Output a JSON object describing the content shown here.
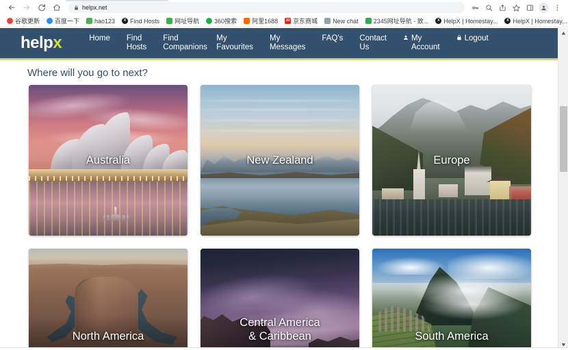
{
  "browser": {
    "back_icon": "back-arrow-icon",
    "forward_icon": "forward-arrow-icon",
    "reload_icon": "reload-icon",
    "home_icon": "home-icon",
    "url": "helpx.net",
    "lock_icon": "lock-icon",
    "actions": [
      {
        "name": "password-key-icon",
        "glyph": "key"
      },
      {
        "name": "zoom-icon",
        "glyph": "zoom"
      },
      {
        "name": "share-icon",
        "glyph": "share"
      },
      {
        "name": "bookmark-star-icon",
        "glyph": "star"
      },
      {
        "name": "side-panel-icon",
        "glyph": "panel"
      },
      {
        "name": "profile-avatar-icon",
        "glyph": "avatar"
      },
      {
        "name": "chrome-menu-icon",
        "glyph": "kebab"
      }
    ],
    "bookmarks": [
      {
        "label": "谷歌更新",
        "color": "#ea4335",
        "mark": "",
        "shape": "circle"
      },
      {
        "label": "百度一下",
        "color": "#2d8cf0",
        "mark": "",
        "shape": "circle"
      },
      {
        "label": "hao123",
        "color": "#4caf50",
        "mark": "",
        "shape": "square"
      },
      {
        "label": "Find Hosts",
        "color": "#1a1a1a",
        "mark": "X",
        "shape": "circle"
      },
      {
        "label": "网址导航",
        "color": "#37b24d",
        "mark": "",
        "shape": "square"
      },
      {
        "label": "360搜索",
        "color": "#1faf4a",
        "mark": "",
        "shape": "circle"
      },
      {
        "label": "阿里1688",
        "color": "#ff6a00",
        "mark": "",
        "shape": "square"
      },
      {
        "label": "京东商城",
        "color": "#e1251b",
        "mark": "JD",
        "shape": "square"
      },
      {
        "label": "New chat",
        "color": "#8fa3a8",
        "mark": "",
        "shape": "square"
      },
      {
        "label": "2345网址导航 - 致...",
        "color": "#3aa757",
        "mark": "",
        "shape": "square"
      },
      {
        "label": "HelpX | Homestay...",
        "color": "#1a1a1a",
        "mark": "X",
        "shape": "circle"
      },
      {
        "label": "HelpX | Homestay...",
        "color": "#1a1a1a",
        "mark": "X",
        "shape": "circle"
      }
    ],
    "bookmarks_overflow": "»"
  },
  "site": {
    "logo": {
      "primary": "help",
      "accent": "x"
    },
    "nav_items": [
      {
        "label": "Home",
        "icon": null
      },
      {
        "label": "Find\nHosts",
        "icon": null
      },
      {
        "label": "Find\nCompanions",
        "icon": null
      },
      {
        "label": "My\nFavourites",
        "icon": null
      },
      {
        "label": "My\nMessages",
        "icon": null
      },
      {
        "label": "FAQ's",
        "icon": null
      },
      {
        "label": "Contact\nUs",
        "icon": null
      },
      {
        "label": "My\nAccount",
        "icon": "user-icon"
      },
      {
        "label": "Logout",
        "icon": "lock-icon"
      }
    ],
    "heading": "Where will you go to next?",
    "colors": {
      "nav_background": "#33506e",
      "nav_accent_border": "#d4de34",
      "heading_text": "#33506e"
    },
    "destinations": [
      {
        "label": "Australia",
        "art": "art-au",
        "short": false
      },
      {
        "label": "New Zealand",
        "art": "art-nz",
        "short": false
      },
      {
        "label": "Europe",
        "art": "art-eu",
        "short": false
      },
      {
        "label": "North America",
        "art": "art-na",
        "short": true
      },
      {
        "label": "Central America\n& Caribbean",
        "art": "art-ca",
        "short": true
      },
      {
        "label": "South America",
        "art": "art-sa",
        "short": true
      }
    ]
  }
}
